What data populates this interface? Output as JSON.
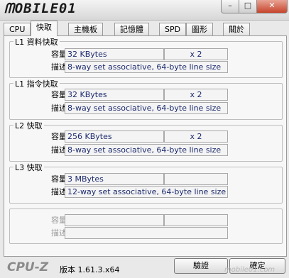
{
  "window": {
    "logo_text": "ᗰOBILE01",
    "min_glyph": "–",
    "max_glyph": "□",
    "close_glyph": "✕"
  },
  "tabs": [
    {
      "label": "CPU"
    },
    {
      "label": "快取"
    },
    {
      "label": "主機板"
    },
    {
      "label": "記憶體"
    },
    {
      "label": "SPD"
    },
    {
      "label": "圖形"
    },
    {
      "label": "關於"
    }
  ],
  "groups": [
    {
      "title": "L1 資料快取",
      "size_label": "容量",
      "size": "32 KBytes",
      "count": "x 2",
      "desc_label": "描述",
      "desc": "8-way set associative, 64-byte line size"
    },
    {
      "title": "L1 指令快取",
      "size_label": "容量",
      "size": "32 KBytes",
      "count": "x 2",
      "desc_label": "描述",
      "desc": "8-way set associative, 64-byte line size"
    },
    {
      "title": "L2 快取",
      "size_label": "容量",
      "size": "256 KBytes",
      "count": "x 2",
      "desc_label": "描述",
      "desc": "8-way set associative, 64-byte line size"
    },
    {
      "title": "L3 快取",
      "size_label": "容量",
      "size": "3 MBytes",
      "count": "",
      "desc_label": "描述",
      "desc": "12-way set associative, 64-byte line size"
    },
    {
      "title": "",
      "size_label": "容量",
      "size": "",
      "count": "",
      "desc_label": "描述",
      "desc": ""
    }
  ],
  "footer": {
    "brand": "CPU-Z",
    "version": "版本 1.61.3.x64",
    "validate_label": "驗證",
    "ok_label": "確定",
    "watermark": "mobile01.com"
  }
}
